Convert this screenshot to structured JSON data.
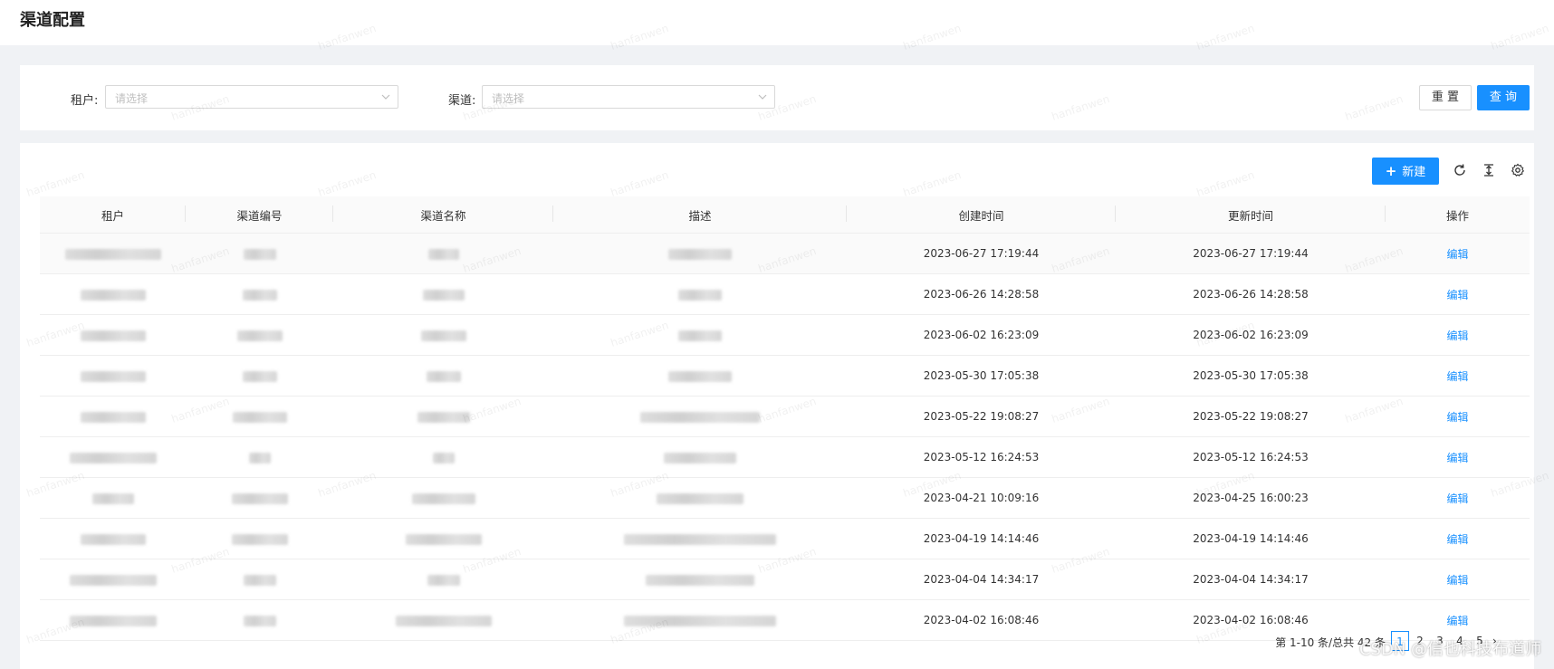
{
  "page": {
    "title": "渠道配置"
  },
  "filters": {
    "tenant_label": "租户:",
    "tenant_placeholder": "请选择",
    "channel_label": "渠道:",
    "channel_placeholder": "请选择",
    "reset_label": "重 置",
    "query_label": "查 询"
  },
  "toolbar": {
    "new_label": "新建",
    "icons": [
      "refresh-icon",
      "column-height-icon",
      "settings-icon"
    ]
  },
  "table": {
    "columns": [
      "租户",
      "渠道编号",
      "渠道名称",
      "描述",
      "创建时间",
      "更新时间",
      "操作"
    ],
    "rows": [
      {
        "created": "2023-06-27 17:19:44",
        "updated": "2023-06-27 17:19:44",
        "action": "编辑"
      },
      {
        "created": "2023-06-26 14:28:58",
        "updated": "2023-06-26 14:28:58",
        "action": "编辑"
      },
      {
        "created": "2023-06-02 16:23:09",
        "updated": "2023-06-02 16:23:09",
        "action": "编辑"
      },
      {
        "created": "2023-05-30 17:05:38",
        "updated": "2023-05-30 17:05:38",
        "action": "编辑"
      },
      {
        "created": "2023-05-22 19:08:27",
        "updated": "2023-05-22 19:08:27",
        "action": "编辑"
      },
      {
        "created": "2023-05-12 16:24:53",
        "updated": "2023-05-12 16:24:53",
        "action": "编辑"
      },
      {
        "created": "2023-04-21 10:09:16",
        "updated": "2023-04-25 16:00:23",
        "action": "编辑"
      },
      {
        "created": "2023-04-19 14:14:46",
        "updated": "2023-04-19 14:14:46",
        "action": "编辑"
      },
      {
        "created": "2023-04-04 14:34:17",
        "updated": "2023-04-04 14:34:17",
        "action": "编辑"
      },
      {
        "created": "2023-04-02 16:08:46",
        "updated": "2023-04-02 16:08:46",
        "action": "编辑"
      }
    ]
  },
  "pagination": {
    "summary": "第 1-10 条/总共 42 条",
    "pages": [
      "1",
      "2",
      "3",
      "4",
      "5"
    ],
    "current": "1"
  },
  "watermark": {
    "text": "hanfanwen"
  },
  "credit": {
    "text": "CSDN @信也科技布道师"
  },
  "colors": {
    "primary": "#1890ff",
    "background": "#f0f2f5"
  }
}
